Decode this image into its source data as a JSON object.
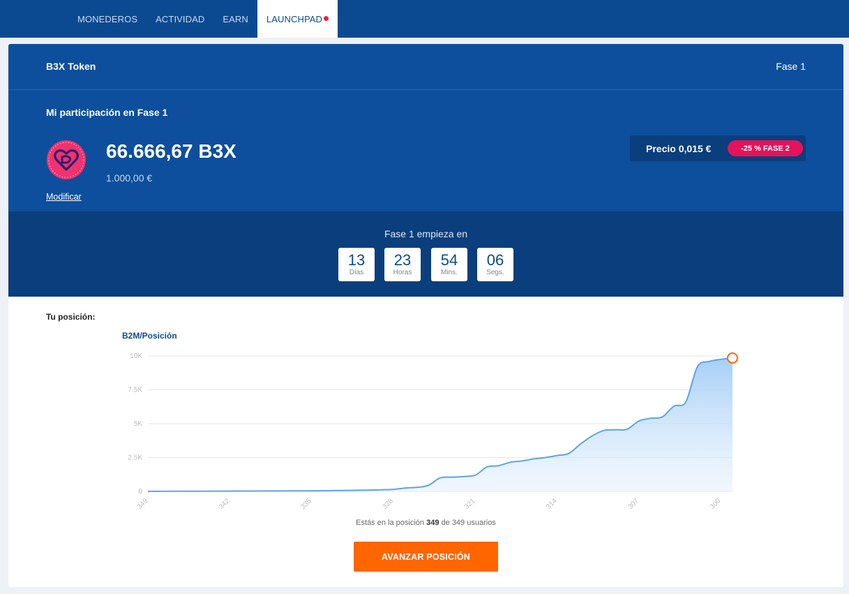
{
  "nav": {
    "items": [
      {
        "label": "MONEDEROS"
      },
      {
        "label": "ACTIVIDAD"
      },
      {
        "label": "EARN"
      },
      {
        "label": "LAUNCHPAD"
      }
    ],
    "active": "LAUNCHPAD"
  },
  "header": {
    "title": "B3X Token",
    "phase": "Fase 1"
  },
  "participation": {
    "title": "Mi participación en Fase 1",
    "amount": "66.666,67 B3X",
    "amount_eur": "1.000,00 €",
    "modify_label": "Modificar",
    "price_label": "Precio 0,015 €",
    "discount_badge": "-25 % FASE 2"
  },
  "countdown": {
    "title": "Fase 1 empieza en",
    "units": [
      {
        "value": "13",
        "label": "Días"
      },
      {
        "value": "23",
        "label": "Horas"
      },
      {
        "value": "54",
        "label": "Mins."
      },
      {
        "value": "06",
        "label": "Segs."
      }
    ]
  },
  "position": {
    "label": "Tu posición:",
    "summary_prefix": "Estás en la posición",
    "position": "349",
    "summary_middle": "de",
    "total": "349",
    "summary_suffix": "usuarios",
    "advance_button": "AVANZAR POSICIÓN"
  },
  "colors": {
    "nav": "#0b4a91",
    "panel": "#0d4f9c",
    "countdown": "#0a3e7c",
    "accent": "#ff6600",
    "badge": "#e6125b",
    "line": "#5ea3e6"
  },
  "chart_data": {
    "type": "area",
    "title": "B2M/Posición",
    "xlabel": "",
    "ylabel": "",
    "x_reversed": true,
    "xlim": [
      349,
      299
    ],
    "ylim": [
      0,
      10000
    ],
    "y_ticks": [
      0,
      2500,
      5000,
      7500,
      10000
    ],
    "y_tick_labels": [
      "0",
      "2.5K",
      "5K",
      "7.5K",
      "10K"
    ],
    "x_ticks": [
      349,
      342,
      335,
      328,
      321,
      314,
      307,
      300
    ],
    "grid": true,
    "highlight_point": {
      "x": 299,
      "y": 9850
    },
    "series": [
      {
        "x": [
          349,
          348,
          347,
          346,
          345,
          344,
          343,
          342,
          341,
          340,
          339,
          338,
          337,
          336,
          335,
          334,
          333,
          332,
          331,
          330,
          329,
          328,
          327,
          326,
          325,
          324,
          323,
          322,
          321,
          320,
          319,
          318,
          317,
          316,
          315,
          314,
          313,
          312,
          311,
          310,
          309,
          308,
          307,
          306,
          305,
          304,
          303,
          302,
          301,
          300,
          299
        ],
        "values": [
          0,
          5,
          10,
          12,
          15,
          18,
          20,
          22,
          25,
          28,
          30,
          32,
          35,
          40,
          45,
          50,
          60,
          70,
          80,
          100,
          120,
          150,
          250,
          300,
          450,
          1000,
          1050,
          1100,
          1200,
          1800,
          1900,
          2150,
          2250,
          2400,
          2500,
          2650,
          2800,
          3500,
          4100,
          4500,
          4550,
          4600,
          5200,
          5400,
          5500,
          6300,
          6600,
          9200,
          9600,
          9750,
          9850
        ]
      }
    ]
  }
}
